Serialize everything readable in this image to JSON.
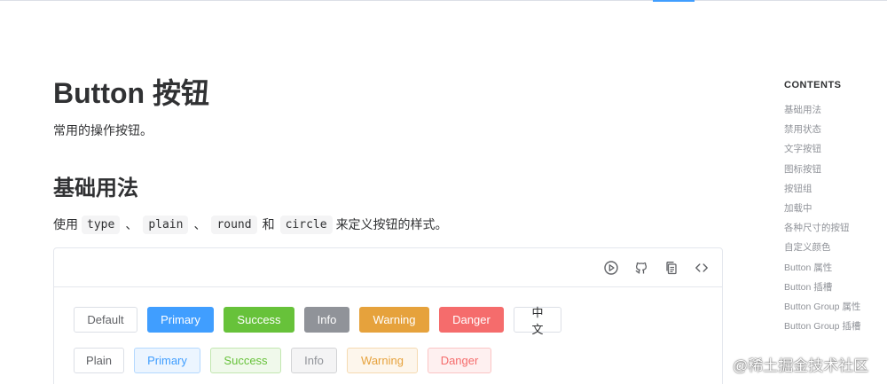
{
  "page": {
    "title": "Button 按钮",
    "description": "常用的操作按钮。",
    "section_title": "基础用法",
    "usage": {
      "prefix": "使用",
      "codes": [
        "type",
        "plain",
        "round",
        "circle"
      ],
      "sep": "、",
      "and": "和",
      "suffix": "来定义按钮的样式。"
    }
  },
  "demo": {
    "toolbar_icons": [
      "play-circle-icon",
      "github-icon",
      "copy-icon",
      "code-icon"
    ],
    "row1": [
      "Default",
      "Primary",
      "Success",
      "Info",
      "Warning",
      "Danger",
      "中文"
    ],
    "row2": [
      "Plain",
      "Primary",
      "Success",
      "Info",
      "Warning",
      "Danger"
    ]
  },
  "toc": {
    "heading": "CONTENTS",
    "items": [
      "基础用法",
      "禁用状态",
      "文字按钮",
      "图标按钮",
      "按钮组",
      "加载中",
      "各种尺寸的按钮",
      "自定义颜色",
      "Button 属性",
      "Button 插槽",
      "Button Group 属性",
      "Button Group 插槽"
    ]
  },
  "watermark": "@稀土掘金技术社区",
  "colors": {
    "primary": "#409eff",
    "success": "#67c23a",
    "info": "#909399",
    "warning": "#e6a23c",
    "danger": "#f56c6c"
  }
}
